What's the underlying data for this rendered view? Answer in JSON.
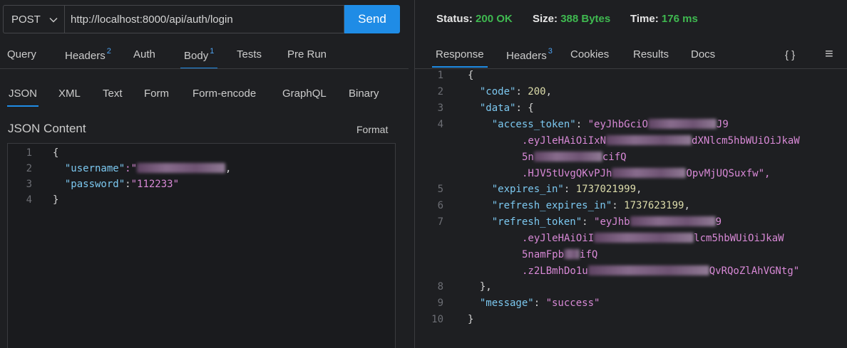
{
  "request": {
    "method": "POST",
    "url": "http://localhost:8000/api/auth/login",
    "send_label": "Send"
  },
  "request_tabs": [
    {
      "label": "Query",
      "badge": ""
    },
    {
      "label": "Headers",
      "badge": "2"
    },
    {
      "label": "Auth",
      "badge": ""
    },
    {
      "label": "Body",
      "badge": "1"
    },
    {
      "label": "Tests",
      "badge": ""
    },
    {
      "label": "Pre Run",
      "badge": ""
    }
  ],
  "body_types": [
    "JSON",
    "XML",
    "Text",
    "Form",
    "Form-encode",
    "GraphQL",
    "Binary"
  ],
  "body_section": {
    "title": "JSON Content",
    "format_label": "Format"
  },
  "request_body": {
    "line_numbers": [
      "1",
      "2",
      "3",
      "4"
    ],
    "open_brace": "{",
    "username_key": "\"username\"",
    "username_open": ":\"",
    "password_key": "\"password\"",
    "password_colon": ":",
    "password_value": "\"112233\"",
    "close_brace": "}"
  },
  "status": {
    "status_label": "Status:",
    "status_value": "200 OK",
    "size_label": "Size:",
    "size_value": "388 Bytes",
    "time_label": "Time:",
    "time_value": "176 ms"
  },
  "response_tabs": [
    {
      "label": "Response",
      "badge": ""
    },
    {
      "label": "Headers",
      "badge": "3"
    },
    {
      "label": "Cookies",
      "badge": ""
    },
    {
      "label": "Results",
      "badge": ""
    },
    {
      "label": "Docs",
      "badge": ""
    }
  ],
  "response_icons": {
    "braces": "{ }",
    "menu": "≡"
  },
  "response_body": {
    "line_numbers": [
      "1",
      "2",
      "3",
      "4",
      "5",
      "6",
      "7",
      "8",
      "9",
      "10"
    ],
    "l1": "{",
    "code_key": "\"code\"",
    "code_value": "200",
    "data_key": "\"data\"",
    "data_open": "{",
    "access_token_key": "\"access_token\"",
    "access_token_p1": "\"eyJhbGciO",
    "access_token_p2": "J9",
    "access_token_p3": ".eyJleHAiOiIxN",
    "access_token_p4": "dXNlcm5hbWUiOiJkaW",
    "access_token_p5": "5n",
    "access_token_p6": "cifQ",
    "access_token_p7": ".HJV5tUvgQKvPJh",
    "access_token_p8": "OpvMjUQSuxfw\",",
    "expires_key": "\"expires_in\"",
    "expires_value": "1737021999",
    "refresh_expires_key": "\"refresh_expires_in\"",
    "refresh_expires_value": "1737623199",
    "refresh_token_key": "\"refresh_token\"",
    "refresh_token_p1": "\"eyJhb",
    "refresh_token_p2": "9",
    "refresh_token_p3": ".eyJleHAiOiI",
    "refresh_token_p4": "lcm5hbWUiOiJkaW",
    "refresh_token_p5": "5namFpb",
    "refresh_token_p6": "ifQ",
    "refresh_token_p7": ".z2LBmhDo1u",
    "refresh_token_p8": "QvRQoZlAhVGNtg\"",
    "data_close": "},",
    "message_key": "\"message\"",
    "message_value": "\"success\"",
    "l10": "}"
  }
}
